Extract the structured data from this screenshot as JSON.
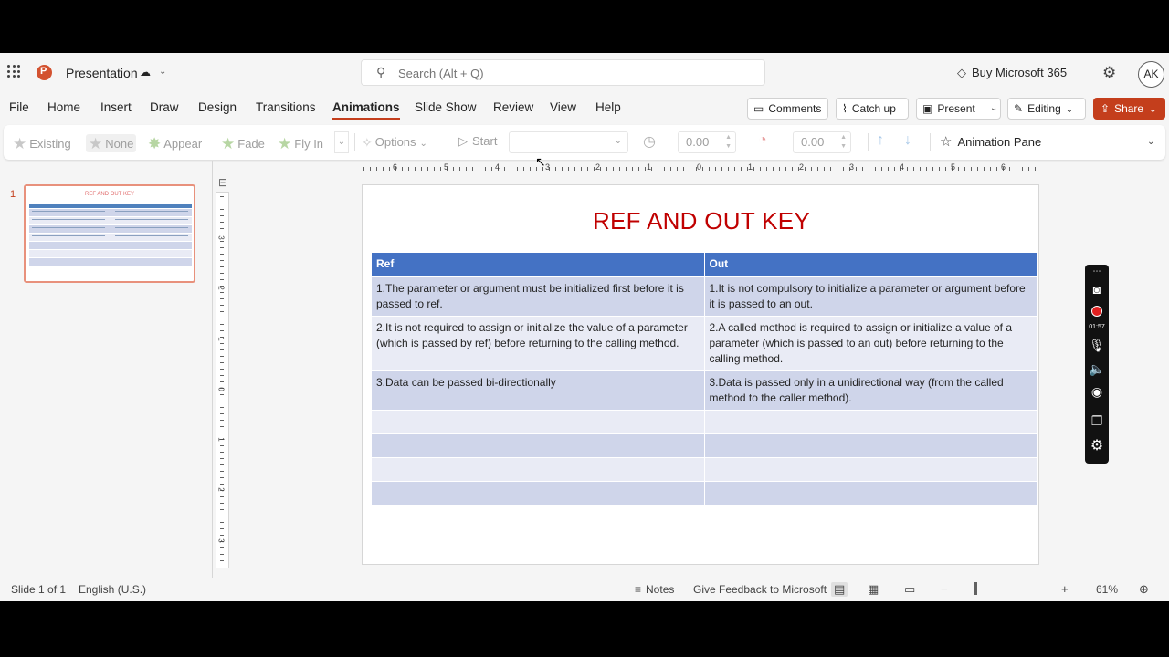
{
  "titlebar": {
    "app_name": "Presentation",
    "status_icon": "cloud-sync-icon",
    "search_placeholder": "Search (Alt + Q)",
    "buy_label": "Buy Microsoft 365",
    "avatar_initials": "AK"
  },
  "tabs": [
    "File",
    "Home",
    "Insert",
    "Draw",
    "Design",
    "Transitions",
    "Animations",
    "Slide Show",
    "Review",
    "View",
    "Help"
  ],
  "active_tab": "Animations",
  "actions": {
    "comments": "Comments",
    "catch_up": "Catch up",
    "present": "Present",
    "editing": "Editing",
    "share": "Share"
  },
  "ribbon": {
    "effects": [
      "Existing",
      "None",
      "Appear",
      "Fade",
      "Fly In"
    ],
    "options": "Options",
    "start": "Start",
    "duration": "0.00",
    "delay": "0.00",
    "animation_pane": "Animation Pane"
  },
  "thumbnail": {
    "number": "1"
  },
  "ruler": {
    "h_labels": [
      "6",
      "5",
      "4",
      "3",
      "2",
      "1",
      "0",
      "1",
      "2",
      "3",
      "4",
      "5",
      "6"
    ],
    "v_labels": [
      "3",
      "2",
      "1",
      "0",
      "1",
      "2",
      "3"
    ]
  },
  "slide": {
    "title": "REF AND OUT KEY",
    "headers": [
      "Ref",
      "Out"
    ],
    "rows": [
      [
        "1.The parameter or argument must be initialized first before it is passed to ref.",
        "1.It is not compulsory to initialize a parameter or argument before it is passed to an out."
      ],
      [
        "2.It is not required to assign or initialize the value of a parameter (which is passed by ref) before returning to the calling method.",
        "2.A called method is required to assign or initialize a value of a parameter (which is passed to an out) before returning to the calling method."
      ],
      [
        "3.Data can be passed bi-directionally",
        "3.Data is passed only in a unidirectional way (from the called method to the caller method)."
      ],
      [
        "",
        ""
      ],
      [
        "",
        ""
      ],
      [
        "",
        ""
      ],
      [
        "",
        ""
      ]
    ]
  },
  "recorder": {
    "time": "01:57"
  },
  "statusbar": {
    "slide_info": "Slide 1 of 1",
    "language": "English (U.S.)",
    "notes": "Notes",
    "feedback": "Give Feedback to Microsoft",
    "zoom": "61%"
  }
}
